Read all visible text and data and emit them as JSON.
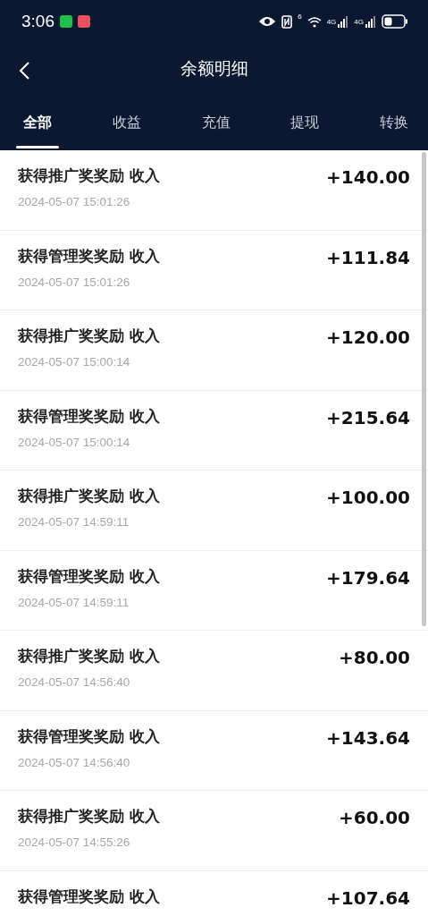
{
  "status_bar": {
    "time": "3:06",
    "wifi_badge": "6",
    "signal_badges": [
      "4G",
      "4G"
    ]
  },
  "header": {
    "title": "余额明细"
  },
  "tabs": [
    {
      "label": "全部",
      "selected": true
    },
    {
      "label": "收益",
      "selected": false
    },
    {
      "label": "充值",
      "selected": false
    },
    {
      "label": "提现",
      "selected": false
    },
    {
      "label": "转换",
      "selected": false
    }
  ],
  "records": [
    {
      "title": "获得推广奖奖励 收入",
      "amount": "+140.00",
      "time": "2024-05-07 15:01:26"
    },
    {
      "title": "获得管理奖奖励 收入",
      "amount": "+111.84",
      "time": "2024-05-07 15:01:26"
    },
    {
      "title": "获得推广奖奖励 收入",
      "amount": "+120.00",
      "time": "2024-05-07 15:00:14"
    },
    {
      "title": "获得管理奖奖励 收入",
      "amount": "+215.64",
      "time": "2024-05-07 15:00:14"
    },
    {
      "title": "获得推广奖奖励 收入",
      "amount": "+100.00",
      "time": "2024-05-07 14:59:11"
    },
    {
      "title": "获得管理奖奖励 收入",
      "amount": "+179.64",
      "time": "2024-05-07 14:59:11"
    },
    {
      "title": "获得推广奖奖励 收入",
      "amount": "+80.00",
      "time": "2024-05-07 14:56:40"
    },
    {
      "title": "获得管理奖奖励 收入",
      "amount": "+143.64",
      "time": "2024-05-07 14:56:40"
    },
    {
      "title": "获得推广奖奖励 收入",
      "amount": "+60.00",
      "time": "2024-05-07 14:55:26"
    },
    {
      "title": "获得管理奖奖励 收入",
      "amount": "+107.64"
    }
  ]
}
